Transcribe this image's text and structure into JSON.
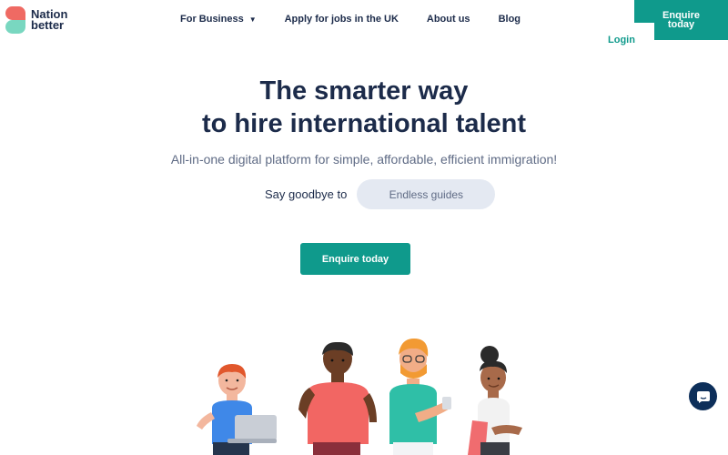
{
  "logo": {
    "line1": "Nation",
    "line2": "better"
  },
  "nav": {
    "items": [
      {
        "label": "For Business",
        "has_dropdown": true
      },
      {
        "label": "Apply for jobs in the UK"
      },
      {
        "label": "About us"
      },
      {
        "label": "Blog"
      }
    ],
    "enquire_line1": "Enquire",
    "enquire_line2": "today",
    "login": "Login"
  },
  "hero": {
    "title_line1": "The smarter way",
    "title_line2": "to hire international talent",
    "subtitle": "All-in-one digital platform for simple, affordable, efficient immigration!",
    "goodbye_label": "Say goodbye to",
    "rotating_word": "Endless guides",
    "cta": "Enquire today"
  },
  "colors": {
    "primary": "#0f9a8c",
    "navy": "#1c2b4a",
    "pill_bg": "#e4e9f2",
    "chat_button": "#0d2f5a"
  },
  "icons": {
    "dropdown": "chevron-down-icon",
    "chat": "chat-bubble-icon"
  }
}
